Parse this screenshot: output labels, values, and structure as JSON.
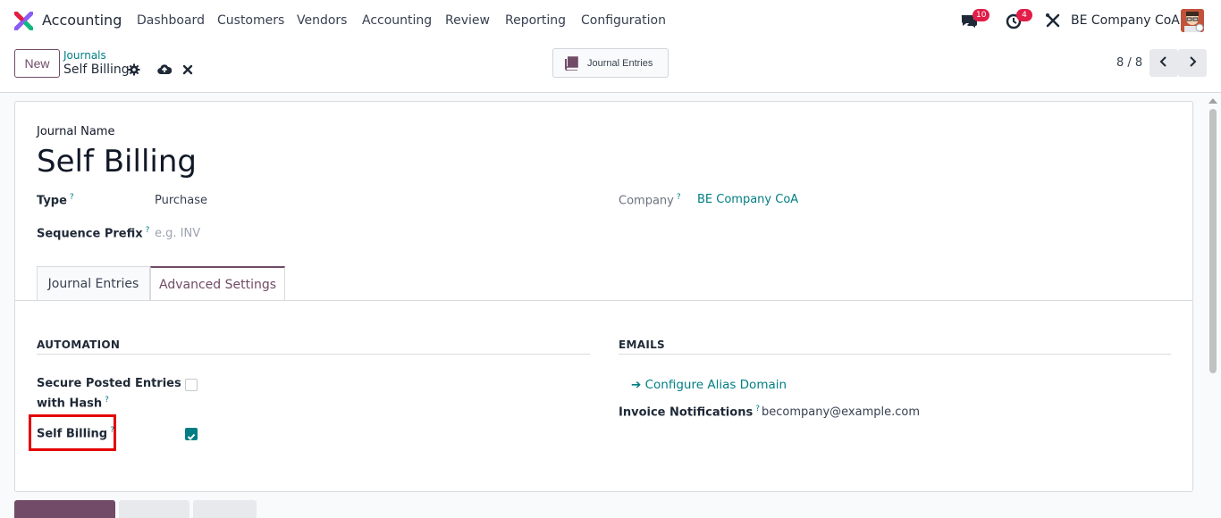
{
  "topbar": {
    "app_name": "Accounting",
    "menu": [
      "Dashboard",
      "Customers",
      "Vendors",
      "Accounting",
      "Review",
      "Reporting",
      "Configuration"
    ],
    "messages_count": "10",
    "activities_count": "4",
    "company": "BE Company CoA",
    "colors": {
      "accent": "#714b67",
      "link": "#017e84",
      "badge": "#e11d48"
    }
  },
  "controlbar": {
    "new_label": "New",
    "breadcrumb_parent": "Journals",
    "breadcrumb_current": "Self Billing",
    "smart_button_label": "Journal Entries",
    "pager": "8 / 8"
  },
  "form": {
    "journal_name_label": "Journal Name",
    "journal_name": "Self Billing",
    "type_label": "Type",
    "type_value": "Purchase",
    "sequence_prefix_label": "Sequence Prefix",
    "sequence_prefix_placeholder": "e.g. INV",
    "company_label": "Company",
    "company_value": "BE Company CoA",
    "help_mark": "?"
  },
  "tabs": [
    {
      "label": "Journal Entries",
      "active": false
    },
    {
      "label": "Advanced Settings",
      "active": true
    }
  ],
  "automation": {
    "title": "AUTOMATION",
    "secure_hash_label_line1": "Secure Posted Entries",
    "secure_hash_label_line2": "with Hash",
    "secure_hash_checked": false,
    "self_billing_label": "Self Billing",
    "self_billing_checked": true
  },
  "emails": {
    "title": "EMAILS",
    "configure_alias_label": "Configure Alias Domain",
    "invoice_notifications_label": "Invoice Notifications",
    "invoice_notifications_value": "becompany@example.com"
  }
}
